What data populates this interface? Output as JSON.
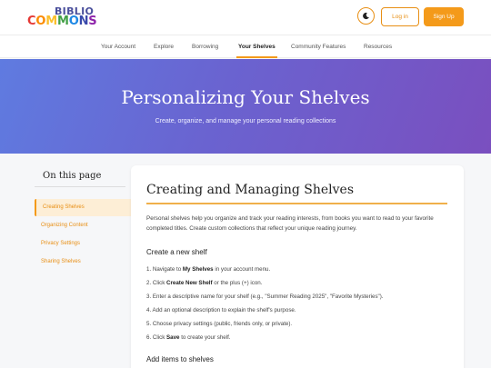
{
  "header": {
    "logo_top": "BIBLIO",
    "logo_letters": [
      {
        "ch": "C",
        "color": "#e53935"
      },
      {
        "ch": "O",
        "color": "#fb8c00"
      },
      {
        "ch": "M",
        "color": "#fbc02d"
      },
      {
        "ch": "M",
        "color": "#43a047"
      },
      {
        "ch": "O",
        "color": "#1e88e5"
      },
      {
        "ch": "N",
        "color": "#3949ab"
      },
      {
        "ch": "S",
        "color": "#8e24aa"
      }
    ],
    "theme_icon": "moon-icon",
    "login_label": "Log in",
    "signup_label": "Sign Up"
  },
  "nav": {
    "items": [
      "Your Account",
      "Explore",
      "Borrowing",
      "Your Shelves",
      "Community Features",
      "Resources"
    ],
    "active": "Your Shelves"
  },
  "hero": {
    "title": "Personalizing Your Shelves",
    "subtitle": "Create, organize, and manage your personal reading collections"
  },
  "sidebar": {
    "title": "On this page",
    "items": [
      "Creating Shelves",
      "Organizing Content",
      "Privacy Settings",
      "Sharing Shelves"
    ],
    "active": "Creating Shelves"
  },
  "content": {
    "title": "Creating and Managing Shelves",
    "intro": "Personal shelves help you organize and track your reading interests, from books you want to read to your favorite completed titles. Create custom collections that reflect your unique reading journey.",
    "section1_heading": "Create a new shelf",
    "steps": [
      {
        "pre": "1. Navigate to ",
        "bold": "My Shelves",
        "post": " in your account menu."
      },
      {
        "pre": "2. Click ",
        "bold": "Create New Shelf",
        "post": " or the plus (+) icon."
      },
      {
        "pre": "3. Enter a descriptive name for your shelf (e.g., \"Summer Reading 2025\", \"Favorite Mysteries\").",
        "bold": "",
        "post": ""
      },
      {
        "pre": "4. Add an optional description to explain the shelf's purpose.",
        "bold": "",
        "post": ""
      },
      {
        "pre": "5. Choose privacy settings (public, friends only, or private).",
        "bold": "",
        "post": ""
      },
      {
        "pre": "6. Click ",
        "bold": "Save",
        "post": " to create your shelf."
      }
    ],
    "section2_heading": "Add items to shelves"
  },
  "colors": {
    "accent": "#f49a1a",
    "hero_start": "#5f7be0",
    "hero_end": "#7a4fbf"
  }
}
